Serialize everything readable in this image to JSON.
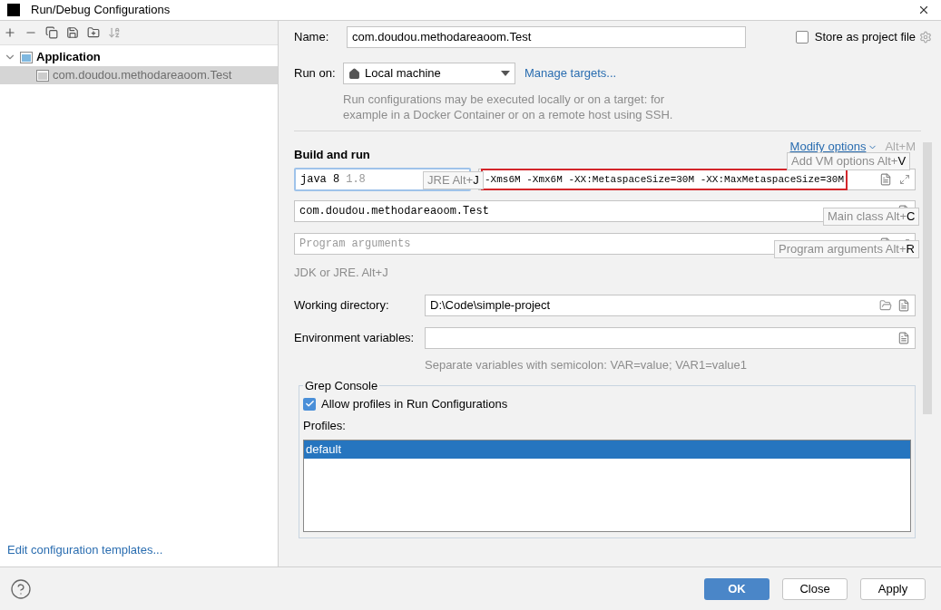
{
  "window": {
    "title": "Run/Debug Configurations"
  },
  "tree": [
    {
      "label": "Application",
      "expanded": true,
      "selected": false,
      "children": [
        {
          "label": "com.doudou.methodareaoom.Test",
          "selected": true
        }
      ]
    }
  ],
  "templates_link": "Edit configuration templates...",
  "name_field": {
    "label": "Name:",
    "value": "com.doudou.methodareaoom.Test"
  },
  "store_as_project_file": {
    "label": "Store as project file",
    "checked": false
  },
  "run_on": {
    "label": "Run on:",
    "value": "Local machine",
    "link": "Manage targets...",
    "note": "Run configurations may be executed locally or on a target: for example in a Docker Container or on a remote host using SSH."
  },
  "build_and_run": {
    "title": "Build and run",
    "modify_options": "Modify options",
    "modify_shortcut": "Alt+M",
    "jre": {
      "name": "java 8",
      "version": "1.8"
    },
    "vm_options": "-Xms6M -Xmx6M -XX:MetaspaceSize=30M -XX:MaxMetaspaceSize=30M",
    "main_class": "com.doudou.methodareaoom.Test",
    "program_arguments_placeholder": "Program arguments",
    "jre_note": "JDK or JRE. Alt+J"
  },
  "hints": [
    {
      "label": "JRE Alt+",
      "key": "J"
    },
    {
      "label": "Add VM options Alt+",
      "key": "V"
    },
    {
      "label": "Main class Alt+",
      "key": "C"
    },
    {
      "label": "Program arguments Alt+",
      "key": "R"
    }
  ],
  "working_directory": {
    "label": "Working directory:",
    "value": "D:\\Code\\simple-project"
  },
  "environment_variables": {
    "label": "Environment variables:",
    "note": "Separate variables with semicolon: VAR=value; VAR1=value1"
  },
  "grep_console": {
    "title": "Grep Console",
    "allow_profiles": {
      "label": "Allow profiles in Run Configurations",
      "checked": true
    },
    "profiles_label": "Profiles:",
    "profiles": [
      {
        "label": "default",
        "selected": true
      }
    ]
  },
  "buttons": [
    {
      "label": "OK",
      "kind": "primary"
    },
    {
      "label": "Close",
      "kind": "default"
    },
    {
      "label": "Apply",
      "kind": "default"
    }
  ]
}
